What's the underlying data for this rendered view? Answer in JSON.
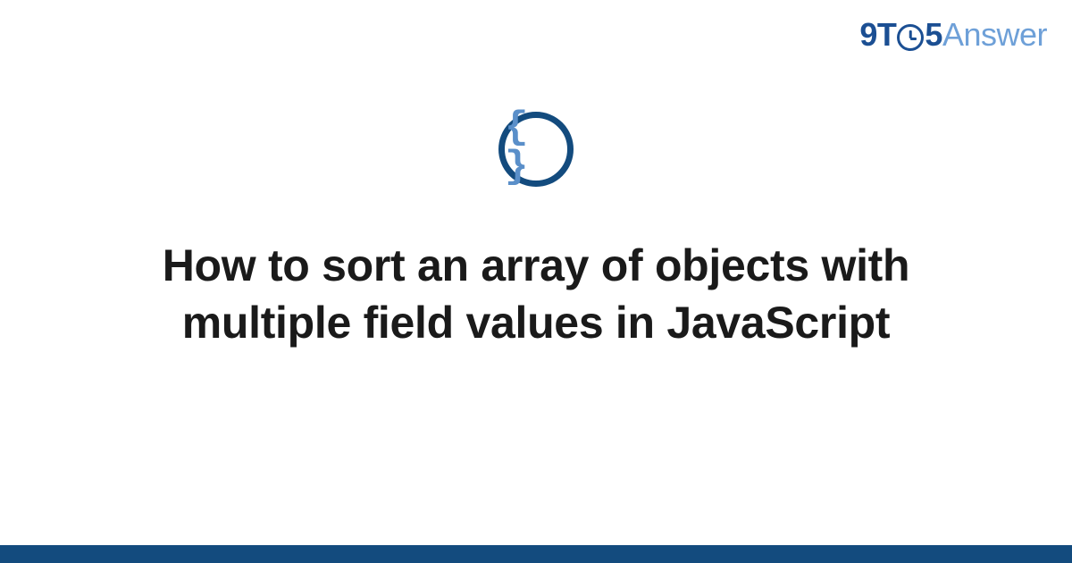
{
  "logo": {
    "part1": "9T",
    "part2": "5",
    "part3": "Answer"
  },
  "category_icon": {
    "glyph": "{ }",
    "name": "code-braces"
  },
  "title": "How to sort an array of objects with multiple field values in JavaScript",
  "colors": {
    "brand_dark": "#134b7e",
    "brand_mid": "#1b4f93",
    "brand_light": "#6ea0d8",
    "icon_brace": "#5a8fc9"
  }
}
